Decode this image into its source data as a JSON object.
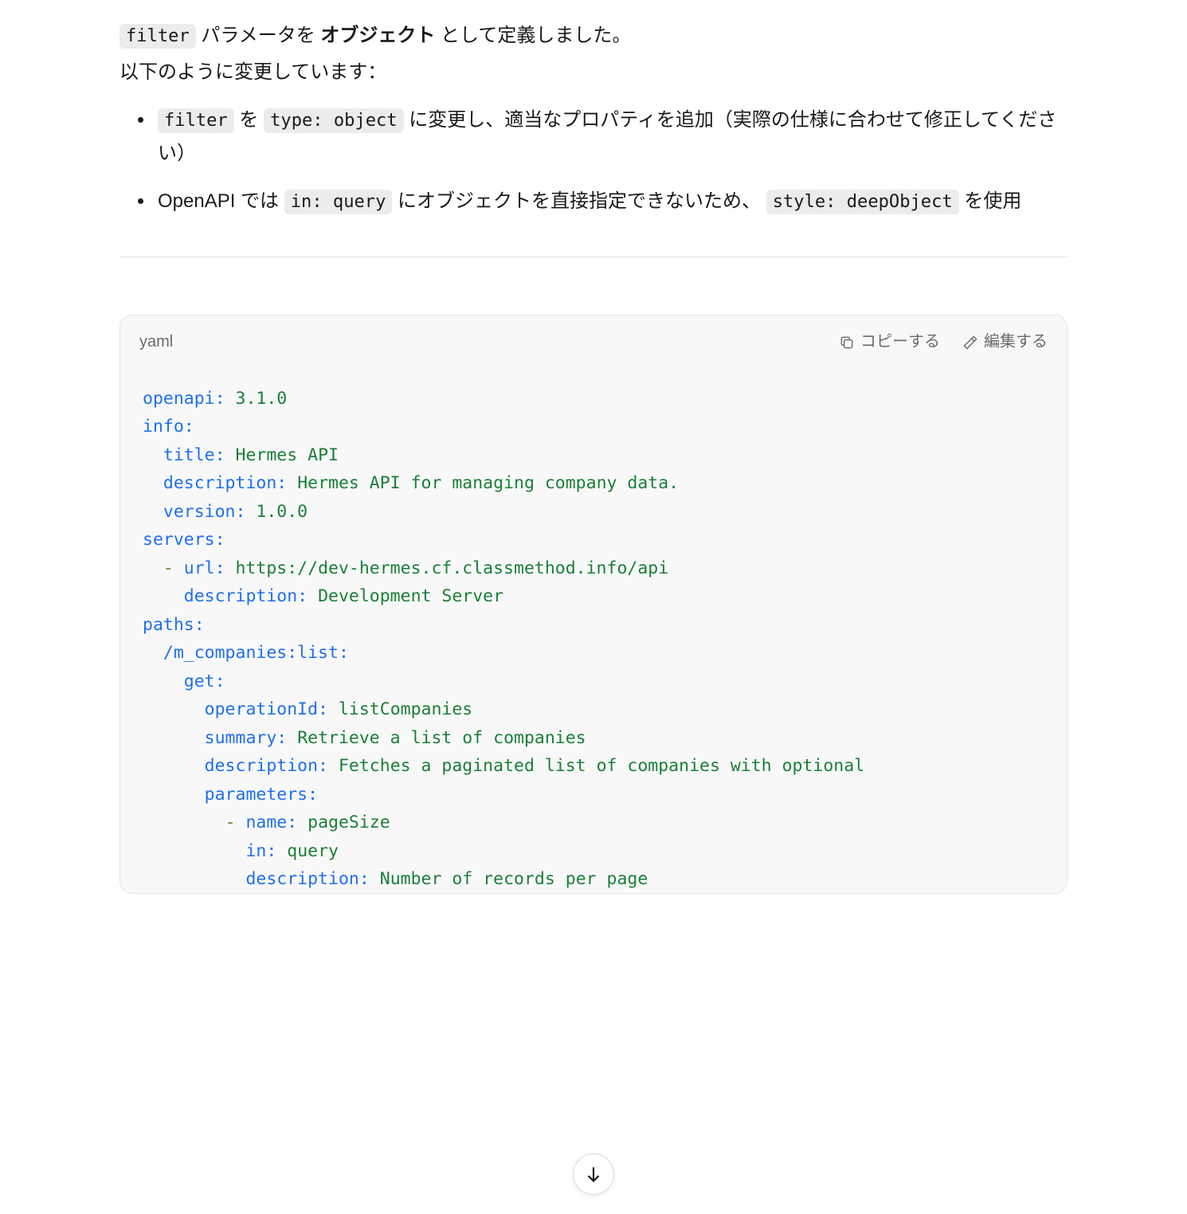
{
  "intro": {
    "line1_code": "filter",
    "line1_text1": " パラメータを ",
    "line1_bold": "オブジェクト",
    "line1_text2": " として定義しました。",
    "line2": "以下のように変更しています："
  },
  "bullets": [
    {
      "parts": [
        {
          "type": "code",
          "val": "filter"
        },
        {
          "type": "text",
          "val": " を "
        },
        {
          "type": "code",
          "val": "type: object"
        },
        {
          "type": "text",
          "val": " に変更し、適当なプロパティを追加（実際の仕様に合わせて修正してください）"
        }
      ]
    },
    {
      "parts": [
        {
          "type": "text",
          "val": "OpenAPI では "
        },
        {
          "type": "code",
          "val": "in: query"
        },
        {
          "type": "text",
          "val": " にオブジェクトを直接指定できないため、 "
        },
        {
          "type": "code",
          "val": "style: deepObject"
        },
        {
          "type": "text",
          "val": " を使用"
        }
      ]
    }
  ],
  "codeblock": {
    "lang": "yaml",
    "actions": {
      "copy": "コピーする",
      "edit": "編集する"
    },
    "lines": [
      [
        {
          "t": "key",
          "v": "openapi:"
        },
        {
          "t": "p",
          "v": " "
        },
        {
          "t": "str",
          "v": "3.1.0"
        }
      ],
      [
        {
          "t": "key",
          "v": "info:"
        }
      ],
      [
        {
          "t": "p",
          "v": "  "
        },
        {
          "t": "key",
          "v": "title:"
        },
        {
          "t": "p",
          "v": " "
        },
        {
          "t": "str",
          "v": "Hermes API"
        }
      ],
      [
        {
          "t": "p",
          "v": "  "
        },
        {
          "t": "key",
          "v": "description:"
        },
        {
          "t": "p",
          "v": " "
        },
        {
          "t": "str",
          "v": "Hermes API for managing company data."
        }
      ],
      [
        {
          "t": "p",
          "v": "  "
        },
        {
          "t": "key",
          "v": "version:"
        },
        {
          "t": "p",
          "v": " "
        },
        {
          "t": "str",
          "v": "1.0.0"
        }
      ],
      [
        {
          "t": "key",
          "v": "servers:"
        }
      ],
      [
        {
          "t": "p",
          "v": "  "
        },
        {
          "t": "dash",
          "v": "- "
        },
        {
          "t": "key",
          "v": "url:"
        },
        {
          "t": "p",
          "v": " "
        },
        {
          "t": "str",
          "v": "https://dev-hermes.cf.classmethod.info/api"
        }
      ],
      [
        {
          "t": "p",
          "v": "    "
        },
        {
          "t": "key",
          "v": "description:"
        },
        {
          "t": "p",
          "v": " "
        },
        {
          "t": "str",
          "v": "Development Server"
        }
      ],
      [
        {
          "t": "key",
          "v": "paths:"
        }
      ],
      [
        {
          "t": "p",
          "v": "  "
        },
        {
          "t": "key",
          "v": "/m_companies:list:"
        }
      ],
      [
        {
          "t": "p",
          "v": "    "
        },
        {
          "t": "key",
          "v": "get:"
        }
      ],
      [
        {
          "t": "p",
          "v": "      "
        },
        {
          "t": "key",
          "v": "operationId:"
        },
        {
          "t": "p",
          "v": " "
        },
        {
          "t": "str",
          "v": "listCompanies"
        }
      ],
      [
        {
          "t": "p",
          "v": "      "
        },
        {
          "t": "key",
          "v": "summary:"
        },
        {
          "t": "p",
          "v": " "
        },
        {
          "t": "str",
          "v": "Retrieve a list of companies"
        }
      ],
      [
        {
          "t": "p",
          "v": "      "
        },
        {
          "t": "key",
          "v": "description:"
        },
        {
          "t": "p",
          "v": " "
        },
        {
          "t": "str",
          "v": "Fetches a paginated list of companies with optional"
        }
      ],
      [
        {
          "t": "p",
          "v": "      "
        },
        {
          "t": "key",
          "v": "parameters:"
        }
      ],
      [
        {
          "t": "p",
          "v": "        "
        },
        {
          "t": "dash",
          "v": "- "
        },
        {
          "t": "key",
          "v": "name:"
        },
        {
          "t": "p",
          "v": " "
        },
        {
          "t": "str",
          "v": "pageSize"
        }
      ],
      [
        {
          "t": "p",
          "v": "          "
        },
        {
          "t": "key",
          "v": "in:"
        },
        {
          "t": "p",
          "v": " "
        },
        {
          "t": "str",
          "v": "query"
        }
      ],
      [
        {
          "t": "p",
          "v": "          "
        },
        {
          "t": "key",
          "v": "description:"
        },
        {
          "t": "p",
          "v": " "
        },
        {
          "t": "str",
          "v": "Number of records per page"
        }
      ]
    ]
  }
}
